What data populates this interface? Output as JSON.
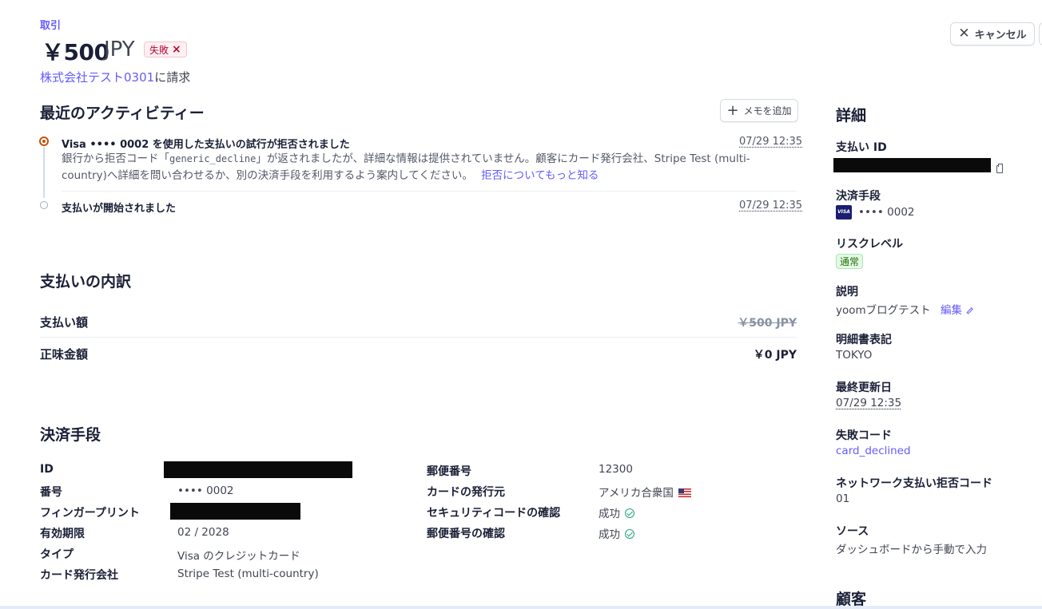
{
  "header": {
    "eyebrow": "取引",
    "amount": "￥500",
    "currency": "JPY",
    "status_badge": "失敗",
    "charge_link": "株式会社テスト0301",
    "charge_suffix": "に請求",
    "cancel_label": "キャンセル"
  },
  "activity": {
    "title": "最近のアクティビティー",
    "add_note_label": "メモを追加",
    "items": [
      {
        "title": "Visa •••• 0002 を使用した支払いの試行が拒否されました",
        "timestamp": "07/29 12:35",
        "desc_before": "銀行から拒否コード「",
        "desc_code": "generic_decline",
        "desc_after": "」が返されましたが、詳細な情報は提供されていません。顧客にカード発行会社、Stripe Test (multi-country)へ詳細を問い合わせるか、別の決済手段を利用するよう案内してください。",
        "learn_more": "拒否についてもっと知る"
      },
      {
        "title": "支払いが開始されました",
        "timestamp": "07/29 12:35"
      }
    ]
  },
  "breakdown": {
    "title": "支払いの内訳",
    "rows": [
      {
        "label": "支払い額",
        "value": "￥500 JPY"
      },
      {
        "label": "正味金額",
        "value": "￥0 JPY"
      }
    ]
  },
  "payment_method": {
    "title": "決済手段",
    "left": [
      {
        "label": "ID",
        "value": ""
      },
      {
        "label": "番号",
        "value": "•••• 0002"
      },
      {
        "label": "フィンガープリント",
        "value": ""
      },
      {
        "label": "有効期限",
        "value": "02 / 2028"
      },
      {
        "label": "タイプ",
        "value": "Visa のクレジットカード"
      },
      {
        "label": "カード発行会社",
        "value": "Stripe Test (multi-country)"
      }
    ],
    "right": [
      {
        "label": "郵便番号",
        "value": "12300"
      },
      {
        "label": "カードの発行元",
        "value": "アメリカ合衆国"
      },
      {
        "label": "セキュリティコードの確認",
        "value": "成功"
      },
      {
        "label": "郵便番号の確認",
        "value": "成功"
      }
    ]
  },
  "details": {
    "title": "詳細",
    "payment_id_label": "支払い ID",
    "method_label": "決済手段",
    "method_value": "•••• 0002",
    "visa_text": "VISA",
    "risk_label": "リスクレベル",
    "risk_value": "通常",
    "description_label": "説明",
    "description_value": "yoomブログテスト",
    "edit_label": "編集",
    "statement_label": "明細書表記",
    "statement_value": "TOKYO",
    "updated_label": "最終更新日",
    "updated_value": "07/29 12:35",
    "failure_code_label": "失敗コード",
    "failure_code_value": "card_declined",
    "network_decline_label": "ネットワーク支払い拒否コード",
    "network_decline_value": "01",
    "source_label": "ソース",
    "source_value": "ダッシュボードから手動で入力",
    "customer_title": "顧客"
  },
  "colors": {
    "accent": "#635bff",
    "fail": "#b3093c",
    "success": "#1ea672",
    "timeline_active": "#c4520f"
  }
}
